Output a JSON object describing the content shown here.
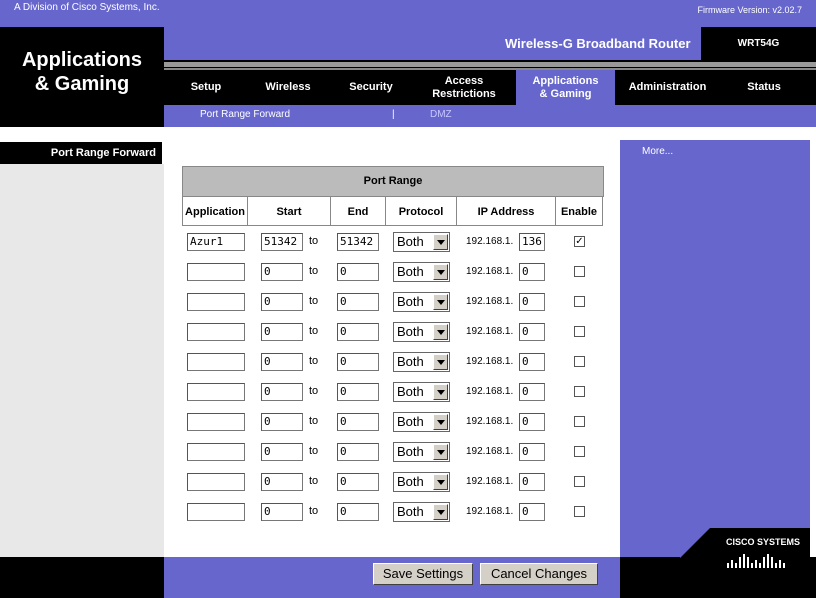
{
  "header": {
    "division": "A Division of Cisco Systems, Inc.",
    "firmware": "Firmware Version: v2.02.7",
    "section_title_1": "Applications",
    "section_title_2": "& Gaming",
    "product": "Wireless-G Broadband Router",
    "model": "WRT54G"
  },
  "tabs": [
    {
      "label": "Setup"
    },
    {
      "label": "Wireless"
    },
    {
      "label": "Security"
    },
    {
      "label1": "Access",
      "label2": "Restrictions"
    },
    {
      "label1": "Applications",
      "label2": "& Gaming"
    },
    {
      "label": "Administration"
    },
    {
      "label": "Status"
    }
  ],
  "subtabs": {
    "active": "Port Range Forward",
    "separator": "|",
    "other": "DMZ"
  },
  "sidebar": {
    "heading": "Port Range Forward",
    "more": "More..."
  },
  "table": {
    "title": "Port Range",
    "headers": [
      "Application",
      "Start",
      "End",
      "Protocol",
      "IP Address",
      "Enable"
    ],
    "to_label": "to",
    "ip_prefix": "192.168.1.",
    "rows": [
      {
        "app": "Azur1",
        "start": "51342",
        "end": "51342",
        "protocol": "Both",
        "ip": "136",
        "enabled": true
      },
      {
        "app": "",
        "start": "0",
        "end": "0",
        "protocol": "Both",
        "ip": "0",
        "enabled": false
      },
      {
        "app": "",
        "start": "0",
        "end": "0",
        "protocol": "Both",
        "ip": "0",
        "enabled": false
      },
      {
        "app": "",
        "start": "0",
        "end": "0",
        "protocol": "Both",
        "ip": "0",
        "enabled": false
      },
      {
        "app": "",
        "start": "0",
        "end": "0",
        "protocol": "Both",
        "ip": "0",
        "enabled": false
      },
      {
        "app": "",
        "start": "0",
        "end": "0",
        "protocol": "Both",
        "ip": "0",
        "enabled": false
      },
      {
        "app": "",
        "start": "0",
        "end": "0",
        "protocol": "Both",
        "ip": "0",
        "enabled": false
      },
      {
        "app": "",
        "start": "0",
        "end": "0",
        "protocol": "Both",
        "ip": "0",
        "enabled": false
      },
      {
        "app": "",
        "start": "0",
        "end": "0",
        "protocol": "Both",
        "ip": "0",
        "enabled": false
      },
      {
        "app": "",
        "start": "0",
        "end": "0",
        "protocol": "Both",
        "ip": "0",
        "enabled": false
      }
    ]
  },
  "buttons": {
    "save": "Save Settings",
    "cancel": "Cancel Changes"
  },
  "logo": {
    "text": "Cisco Systems"
  },
  "colors": {
    "brand_purple": "#6666cc",
    "black": "#000000"
  }
}
